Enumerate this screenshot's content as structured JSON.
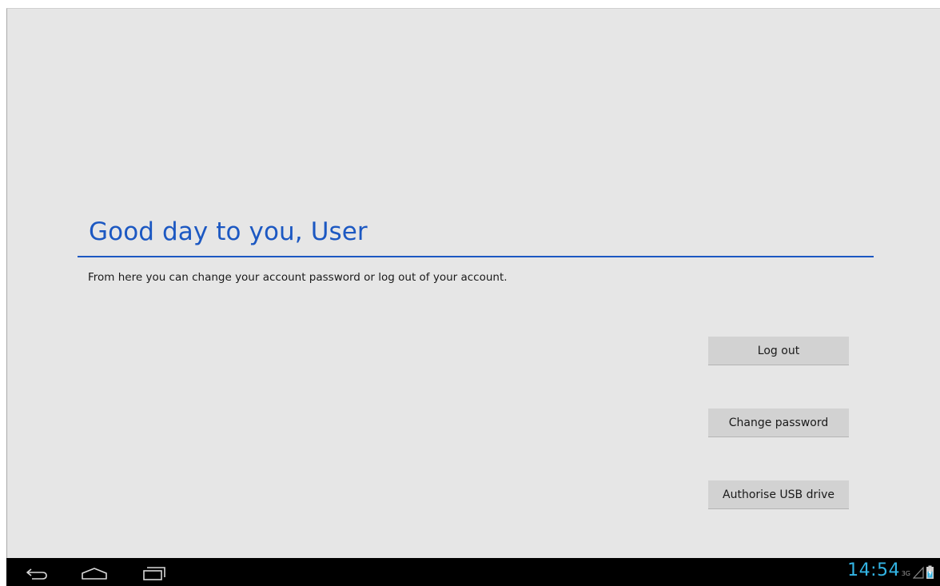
{
  "account": {
    "greeting": "Good day to you, User",
    "description": "From here you can change your account password or log out of your account.",
    "buttons": {
      "log_out": "Log out",
      "change_password": "Change password",
      "authorise_usb": "Authorise USB drive"
    }
  },
  "colors": {
    "accent": "#1c58c2",
    "background": "#e6e6e6",
    "button": "#d2d2d2",
    "navbar": "#000000",
    "clock": "#33b5e5"
  },
  "navbar": {
    "icons": [
      "back-icon",
      "home-icon",
      "recent-apps-icon"
    ],
    "status": {
      "time": "14:54",
      "network_type": "3G",
      "status_icons": [
        "signal-icon",
        "battery-charging-icon"
      ]
    }
  }
}
